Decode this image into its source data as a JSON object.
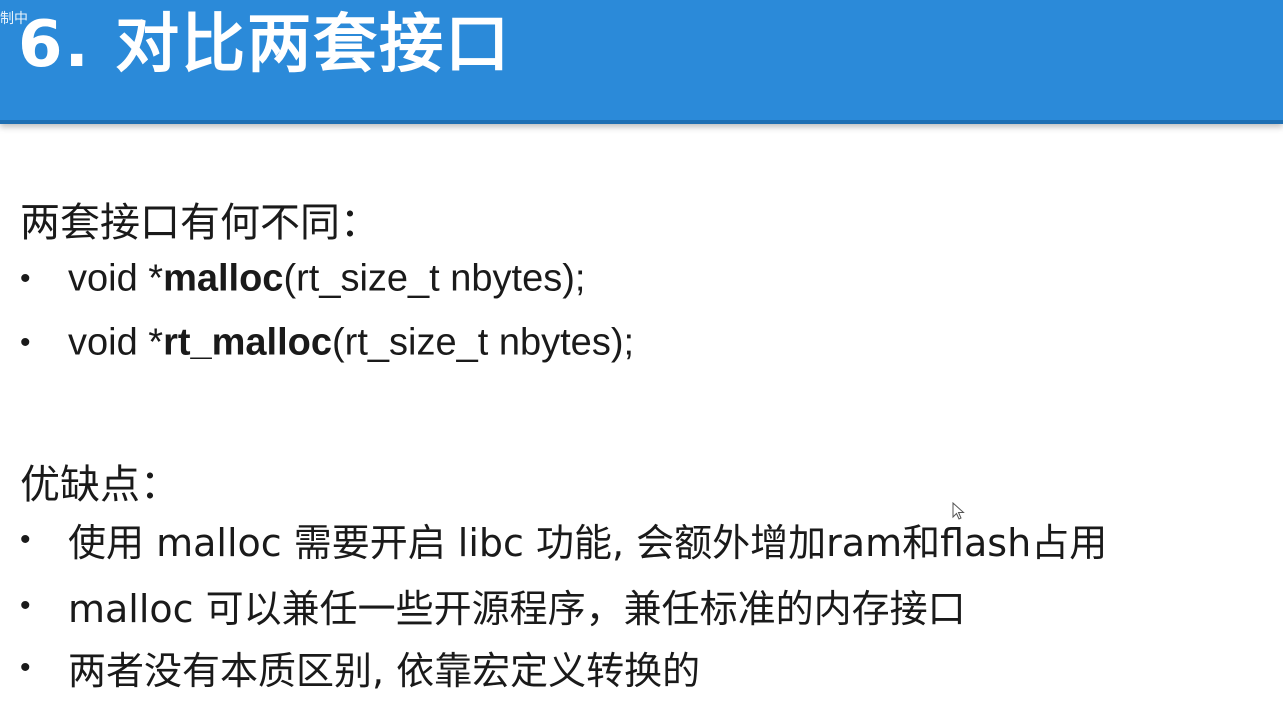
{
  "header": {
    "corner_tag": "制中",
    "title": "6. 对比两套接口"
  },
  "section1": {
    "heading": "两套接口有何不同：",
    "items": [
      {
        "prefix": "void *",
        "fn": "malloc",
        "suffix": "(rt_size_t nbytes);"
      },
      {
        "prefix": "void *",
        "fn": "rt_malloc",
        "suffix": "(rt_size_t nbytes);"
      }
    ]
  },
  "section2": {
    "heading": "优缺点：",
    "items": [
      "使用 malloc 需要开启 libc 功能, 会额外增加ram和flash占用",
      "malloc 可以兼任一些开源程序，兼任标准的内存接口",
      "两者没有本质区别, 依靠宏定义转换的"
    ]
  },
  "bullet_glyph": "•",
  "colors": {
    "header_bg": "#2b8ad9",
    "header_border": "#1e6fb3",
    "text": "#1a1a1a"
  }
}
